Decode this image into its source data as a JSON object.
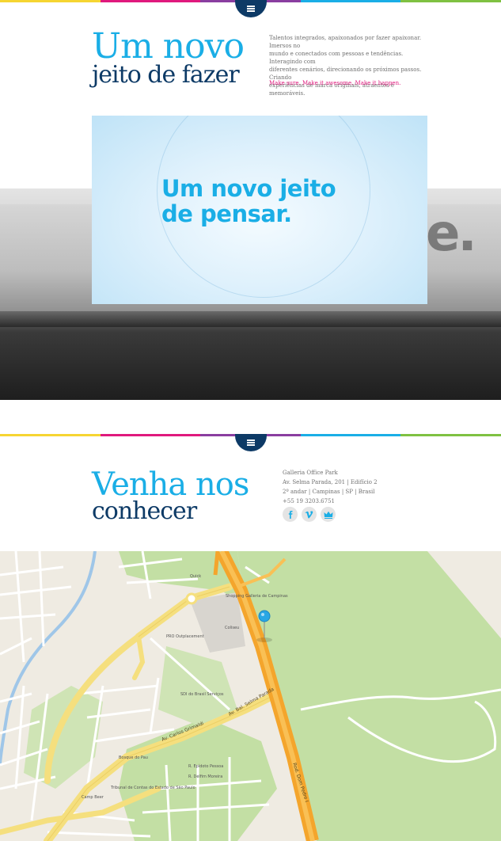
{
  "colors": {
    "stripe": [
      "#f6d532",
      "#e0197d",
      "#8a3ea0",
      "#1aaee6",
      "#7fc142"
    ],
    "navy": "#0d3a66",
    "blue": "#1aaee6",
    "pink": "#e0197d"
  },
  "menu": {
    "icon": "hamburger-icon"
  },
  "intro": {
    "headline_line1": "Um novo",
    "headline_line2": "jeito de fazer",
    "body_lines": [
      "Talentos integrados, apaixonados por fazer apaixonar. Imersos no",
      "mundo e conectados com pessoas e tendências. Interagindo com",
      "diferentes cenários, direcionando os próximos passos. Criando",
      "experiências de marca originais, atraentes e memoráveis."
    ],
    "tagline": "Make sure. Make it awesome. Make it happen."
  },
  "video": {
    "line1": "Um novo jeito",
    "line2": "de pensar."
  },
  "contact": {
    "headline_line1": "Venha nos",
    "headline_line2": "conhecer",
    "address_lines": [
      "Galleria Office Park",
      "Av. Selma Parada, 201 | Edifício 2",
      "2º andar | Campinas | SP | Brasil",
      "+55 19 3203.6751"
    ],
    "socials": [
      {
        "icon": "facebook-icon",
        "glyph": "f"
      },
      {
        "icon": "vimeo-icon",
        "glyph": "v"
      },
      {
        "icon": "crown-icon",
        "glyph": "♛"
      }
    ]
  },
  "map": {
    "labels": {
      "rod_dom_pedro": "Rod. Dom Pedro I",
      "av_carlos_grimaldi": "Av. Carlos Grimaldi",
      "av_bal_selma_parada": "Av. Bal. Selma Parada",
      "shopping": "Shopping Galleria de Campinas",
      "quick": "Quick",
      "colisei": "Coliseu",
      "pro_outplacement": "PRO Outplacement",
      "sesi": "SDI do Brasil Serviços",
      "epidoto": "R. Epídoto Pessoa",
      "delfin": "R. Delfim Moreira",
      "tribunal": "Tribunal de Contas do Estado de São Paulo",
      "camp_beer": "Camp Beer",
      "bosque": "Bosque do Pau"
    }
  }
}
